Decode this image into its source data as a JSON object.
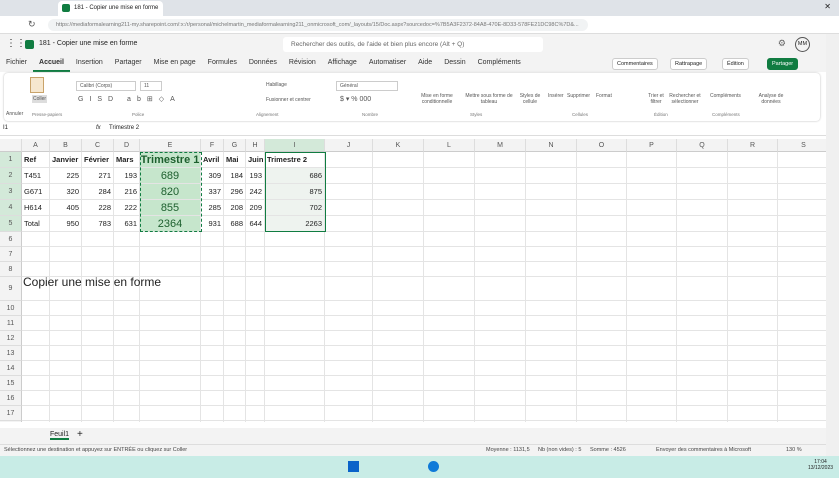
{
  "browser": {
    "tab_title": "181 - Copier une mise en forme",
    "url": "https://mediaformalearning211-my.sharepoint.com/:x:/r/personal/michelmartin_mediaformalearning211_onmicrosoft_com/_layouts/15/Doc.aspx?sourcedoc=%7B5A3F2372-84A8-470E-8D33-578FE21DC98C%7D&..."
  },
  "app": {
    "doc_title": "181 - Copier une mise en forme",
    "search_placeholder": "Rechercher des outils, de l'aide et bien plus encore (Alt + Q)",
    "avatar": "MM"
  },
  "menu": [
    "Fichier",
    "Accueil",
    "Insertion",
    "Partager",
    "Mise en page",
    "Formules",
    "Données",
    "Révision",
    "Affichage",
    "Automatiser",
    "Aide",
    "Dessin",
    "Compléments"
  ],
  "header_buttons": {
    "comments": "Commentaires",
    "catchup": "Rattrapage",
    "edit": "Édition",
    "share": "Partager"
  },
  "ribbon": {
    "undo": "Annuler",
    "paste": "Coller",
    "clipboard": "Presse-papiers",
    "font": "Calibri (Corps)",
    "size": "11",
    "font_group": "Police",
    "wrap": "Habillage",
    "merge": "Fusionner et centrer",
    "align_group": "Alignement",
    "numfmt": "Général",
    "number_group": "Nombre",
    "cond": "Mise en forme conditionnelle",
    "table": "Mettre sous forme de tableau",
    "cellstyles": "Styles de cellule",
    "styles_group": "Styles",
    "insert": "Insérer",
    "delete": "Supprimer",
    "format": "Format",
    "cells_group": "Cellules",
    "sort": "Trier et filtrer",
    "find": "Rechercher et sélectionner",
    "edit_group": "Édition",
    "addins": "Compléments",
    "addins_group": "Compléments",
    "analyze": "Analyse de données"
  },
  "formula_bar": {
    "name_box": "I1",
    "fx": "fx",
    "value": "Trimestre 2"
  },
  "columns": [
    "A",
    "B",
    "C",
    "D",
    "E",
    "F",
    "G",
    "H",
    "I",
    "J",
    "K",
    "L",
    "M",
    "N",
    "O",
    "P",
    "Q",
    "R",
    "S"
  ],
  "rows": [
    [
      "Ref",
      "Janvier",
      "Février",
      "Mars",
      "Trimestre 1",
      "Avril",
      "Mai",
      "Juin",
      "Trimestre 2"
    ],
    [
      "T451",
      "225",
      "271",
      "193",
      "689",
      "309",
      "184",
      "193",
      "686"
    ],
    [
      "G671",
      "320",
      "284",
      "216",
      "820",
      "337",
      "296",
      "242",
      "875"
    ],
    [
      "H614",
      "405",
      "228",
      "222",
      "855",
      "285",
      "208",
      "209",
      "702"
    ],
    [
      "Total",
      "950",
      "783",
      "631",
      "2364",
      "931",
      "688",
      "644",
      "2263"
    ]
  ],
  "row9_text": "Copier une mise en forme",
  "sheet_tab": "Feuil1",
  "status": {
    "message": "Sélectionnez une destination et appuyez sur ENTRÉE ou cliquez sur Coller",
    "average": "Moyenne : 1131,5",
    "count": "Nb (non vides) : 5",
    "sum": "Somme : 4526",
    "feedback": "Envoyer des commentaires à Microsoft",
    "zoom": "130 %"
  },
  "taskbar": {
    "time": "17:04",
    "date": "13/12/2023"
  },
  "colors": {
    "accent": "#107c41",
    "selection_fill": "#c6e6cc"
  }
}
